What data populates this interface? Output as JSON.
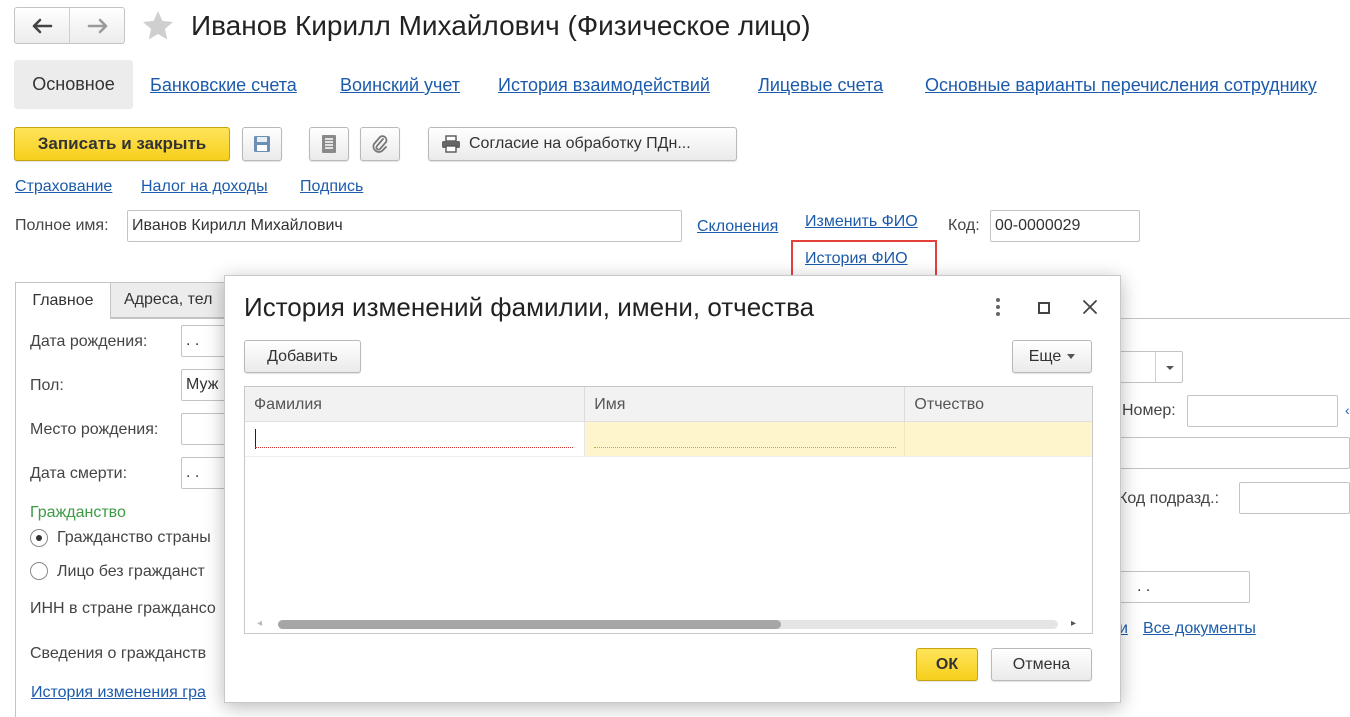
{
  "window": {
    "title": "Иванов Кирилл Михайлович (Физическое лицо)"
  },
  "nav_tabs": [
    {
      "label": "Основное",
      "active": true
    },
    {
      "label": "Банковские счета"
    },
    {
      "label": "Воинский учет"
    },
    {
      "label": "История взаимодействий"
    },
    {
      "label": "Лицевые счета"
    },
    {
      "label": "Основные варианты перечисления сотруднику"
    }
  ],
  "toolbar": {
    "save_close_label": "Записать и закрыть",
    "consent_label": "Согласие на обработку ПДн..."
  },
  "sublinks": [
    "Страхование",
    "Налог на доходы",
    "Подпись"
  ],
  "fullname": {
    "label": "Полное имя:",
    "value": "Иванов Кирилл Михайлович",
    "declension_link": "Склонения",
    "change_link": "Изменить ФИО",
    "history_link": "История ФИО",
    "code_label": "Код:",
    "code_value": "00-0000029"
  },
  "inner_tabs": [
    {
      "label": "Главное",
      "active": true
    },
    {
      "label": "Адреса, тел"
    }
  ],
  "main_form": {
    "birth_date_label": "Дата рождения:",
    "birth_date_value": " .  .",
    "gender_label": "Пол:",
    "gender_value": "Муж",
    "birth_place_label": "Место рождения:",
    "death_date_label": "Дата смерти:",
    "death_date_value": " .  .",
    "citizenship_header": "Гражданство",
    "citizenship_option1": "Гражданство страны",
    "citizenship_option2": "Лицо без гражданст",
    "inn_label": "ИНН в стране граждансо",
    "citizenship_info_label": "Сведения о гражданств",
    "citizenship_history_link": "История изменения гра"
  },
  "right_form": {
    "number_label": "Номер:",
    "subdiv_code_label": "Код подразд.:",
    "date_value": ".  .",
    "docs_link_partial": "и",
    "all_docs_link": "Все документы"
  },
  "dialog": {
    "title": "История изменений фамилии, имени, отчества",
    "add_button": "Добавить",
    "more_button": "Еще",
    "columns": [
      "Фамилия",
      "Имя",
      "Отчество"
    ],
    "ok_button": "ОК",
    "cancel_button": "Отмена"
  },
  "colors": {
    "link": "#1c5bab",
    "accent_yellow": "#f6cf1c",
    "highlight_red": "#e3403a",
    "citizenship_green": "#3d9a45",
    "row_highlight": "#fff5cc"
  }
}
